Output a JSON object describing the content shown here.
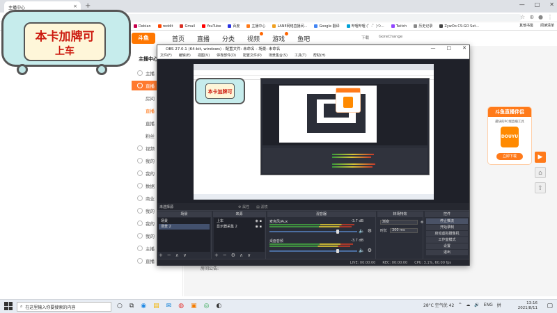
{
  "browser": {
    "tab_title": "主播中心",
    "tab_close": "×",
    "new_tab": "+",
    "controls": [
      "—",
      "□",
      "✕"
    ],
    "nav": [
      "←",
      "→",
      "↻"
    ],
    "url": "",
    "addr_icons": [
      "☆",
      "⊕",
      "●",
      "⋮"
    ],
    "bookmarks": [
      {
        "label": "Debian",
        "color": "#c7004c"
      },
      {
        "label": "reddit",
        "color": "#ff4500"
      },
      {
        "label": "Gmail",
        "color": "#d93025"
      },
      {
        "label": "YouTube",
        "color": "#ff0000"
      },
      {
        "label": "百度",
        "color": "#2932e1"
      },
      {
        "label": "主播中心",
        "color": "#ff7a1a"
      },
      {
        "label": "LANE网络直播间...",
        "color": "#f0a020"
      },
      {
        "label": "Google 翻译",
        "color": "#4285f4"
      },
      {
        "label": "哔哩哔哩 (゜-゜)つ...",
        "color": "#00a1d6"
      },
      {
        "label": "Twitch",
        "color": "#9146ff"
      },
      {
        "label": "历史记录",
        "color": "#888888"
      },
      {
        "label": "ZywOo CS:GO Set...",
        "color": "#444444"
      }
    ],
    "bookmarks_right": [
      "其他书签",
      "阅读清单"
    ]
  },
  "douyu": {
    "logo": "斗鱼",
    "nav": [
      "首页",
      "直播",
      "分类",
      "视频",
      "游戏",
      "鱼吧"
    ],
    "nav_badges": [
      false,
      false,
      false,
      true,
      true,
      false
    ],
    "right": [
      "下载",
      "GoreChange"
    ],
    "section_title": "主播中心",
    "sidebar": [
      {
        "label": "主播",
        "cls": ""
      },
      {
        "label": "直播",
        "cls": "active"
      },
      {
        "label": "房间",
        "cls": "sub"
      },
      {
        "label": "直播",
        "cls": "sub orange"
      },
      {
        "label": "直播",
        "cls": "sub"
      },
      {
        "label": "粉丝",
        "cls": "sub"
      },
      {
        "label": "视频",
        "cls": ""
      },
      {
        "label": "我的",
        "cls": ""
      },
      {
        "label": "我的",
        "cls": ""
      },
      {
        "label": "数据",
        "cls": ""
      },
      {
        "label": "商业",
        "cls": ""
      },
      {
        "label": "我的",
        "cls": ""
      },
      {
        "label": "我的",
        "cls": ""
      },
      {
        "label": "我的",
        "cls": ""
      },
      {
        "label": "主播",
        "cls": ""
      },
      {
        "label": "直播",
        "cls": ""
      }
    ],
    "notice": "房间公告:"
  },
  "badge": {
    "line1": "本卡加牌可",
    "line2": "上车"
  },
  "promo": {
    "title": "斗鱼直播伴侣",
    "subtitle": "最快的PC端直播工具",
    "logo": "DOUYU",
    "button": "立即下载"
  },
  "side_buttons": [
    "▶",
    "⌂",
    "⇧"
  ],
  "obs": {
    "title": "OBS 27.0.1 (64-bit, windows) - 配置文件: 未命名 - 场景: 未命名",
    "controls": [
      "—",
      "□",
      "✕"
    ],
    "menu": [
      "文件(F)",
      "编辑(E)",
      "视图(V)",
      "停靠部件(D)",
      "配置文件(P)",
      "场景集合(S)",
      "工具(T)",
      "帮助(H)"
    ],
    "scene_selected": "未选择源",
    "toolbar": [
      "⚙ 属性",
      "▤ 滤镜"
    ],
    "scenes_title": "场景",
    "scenes": [
      "场景",
      "场景 2"
    ],
    "sources_title": "来源",
    "sources": [
      "上车",
      "显示器采集 2"
    ],
    "mixer_title": "混音器",
    "tracks": [
      {
        "name": "麦克风/Aux",
        "db": "-3.7 dB"
      },
      {
        "name": "桌面音频",
        "db": "-3.7 dB"
      }
    ],
    "transitions_title": "转场特效",
    "transition_type": "渐变",
    "duration_label": "时长",
    "duration_value": "300 ms",
    "controls_title": "控件",
    "control_buttons": [
      "停止推流",
      "开始录制",
      "启动虚拟摄像机",
      "工作室模式",
      "设置",
      "退出"
    ],
    "status": [
      "LIVE: 00:00:00",
      "REC: 00:00:00",
      "CPU: 3.1%, 60.00 fps"
    ],
    "dock_foot": [
      "+",
      "−",
      "∧",
      "∨"
    ]
  },
  "taskbar": {
    "search_placeholder": "在这里输入你要搜索的内容",
    "apps": [
      "○",
      "⧉",
      "◉",
      "▤",
      "✉",
      "◍",
      "▣",
      "◎",
      "◐"
    ],
    "tray": [
      "28°C 空气优 42",
      "^",
      "☁",
      "🔊",
      "ENG",
      "拼"
    ],
    "time": "13:16",
    "date": "2021/8/11",
    "notif": "▢"
  }
}
